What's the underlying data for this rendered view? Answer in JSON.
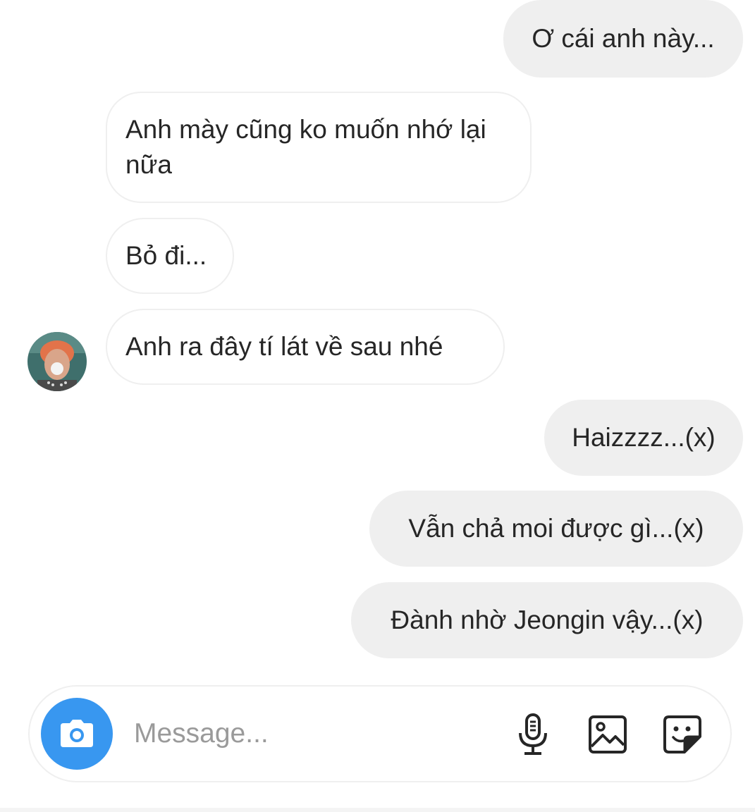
{
  "messages": [
    {
      "direction": "outgoing",
      "text": "Ơ cái anh này..."
    },
    {
      "direction": "incoming",
      "text": "Anh mày cũng ko muốn nhớ lại nữa"
    },
    {
      "direction": "incoming",
      "text": "Bỏ đi..."
    },
    {
      "direction": "incoming",
      "text": "Anh ra đây tí lát về sau nhé"
    },
    {
      "direction": "outgoing",
      "text": "Haizzzz...(x)"
    },
    {
      "direction": "outgoing",
      "text": "Vẫn chả moi được gì...(x)"
    },
    {
      "direction": "outgoing",
      "text": "Đành nhờ Jeongin vậy...(x)"
    }
  ],
  "avatar": {
    "icon": "user-avatar"
  },
  "composer": {
    "placeholder": "Message...",
    "camera_icon": "camera-icon",
    "mic_icon": "microphone-icon",
    "gallery_icon": "image-gallery-icon",
    "sticker_icon": "sticker-icon"
  },
  "colors": {
    "outgoing_bubble": "#efefef",
    "incoming_border": "#efefef",
    "camera_button": "#3897f0",
    "text": "#262626",
    "placeholder": "#9a9a9a"
  }
}
